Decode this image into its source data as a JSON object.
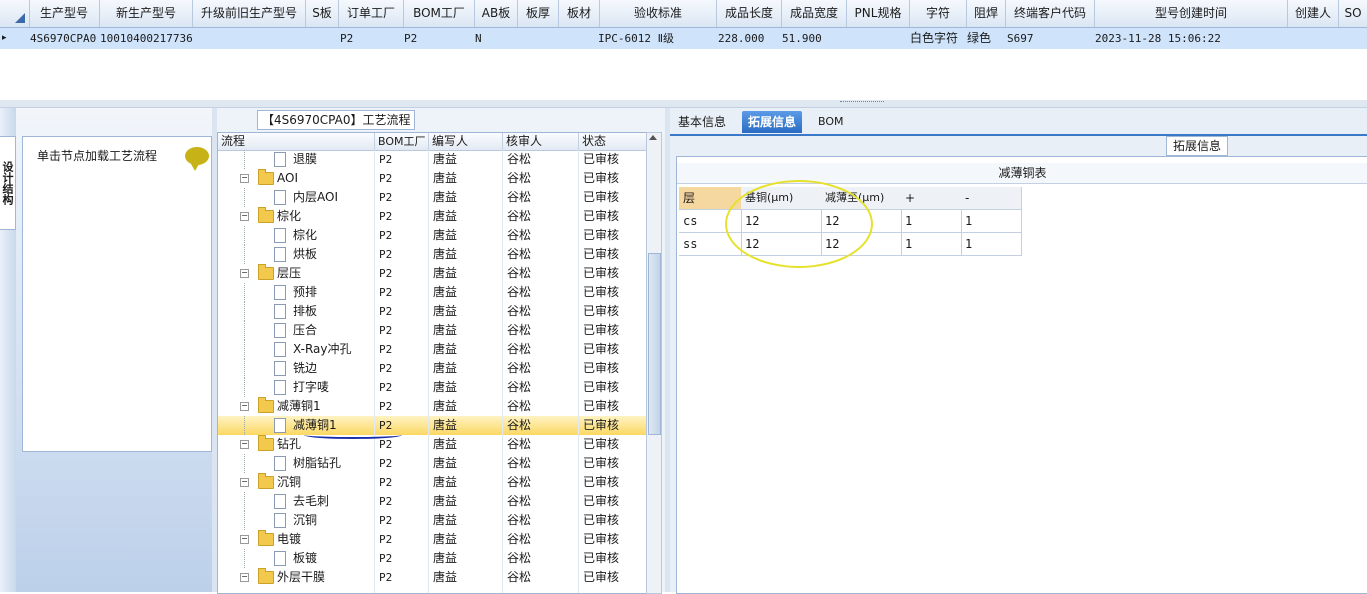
{
  "top_grid": {
    "columns": [
      "生产型号",
      "新生产型号",
      "升级前旧生产型号",
      "S板",
      "订单工厂",
      "BOM工厂",
      "AB板",
      "板厚",
      "板材",
      "验收标准",
      "成品长度",
      "成品宽度",
      "PNL规格",
      "字符",
      "阻焊",
      "终端客户代码",
      "型号创建时间",
      "创建人",
      "SO"
    ],
    "row": {
      "prod_model": "4S6970CPA0",
      "new_model": "10010400217736",
      "old_model": "",
      "s_board": "P2",
      "order_factory": "",
      "bom_factory": "P2",
      "ab_board": "N",
      "thickness": "",
      "material": "",
      "standard": "IPC-6012 Ⅱ级",
      "length": "228.000",
      "width": "51.900",
      "pnl": "",
      "char": "白色字符",
      "mask": "绿色",
      "customer": "S697",
      "created": "2023-11-28 15:06:22",
      "creator": "",
      "so": ""
    }
  },
  "left_panel": {
    "vertical_tab": "设计结构",
    "hint": "单击节点加载工艺流程",
    "bubble_icon": "speech-bubble-icon"
  },
  "mid_panel": {
    "title": "【4S6970CPA0】工艺流程",
    "headers": [
      "流程",
      "BOM工厂",
      "编写人",
      "核审人",
      "状态"
    ],
    "rows": [
      {
        "name": "退膜",
        "level": 1,
        "type": "page",
        "bom": "P2",
        "writer": "唐益",
        "reviewer": "谷松",
        "status": "已审核"
      },
      {
        "name": "AOI",
        "level": 0,
        "type": "folder",
        "bom": "P2",
        "writer": "唐益",
        "reviewer": "谷松",
        "status": "已审核"
      },
      {
        "name": "内层AOI",
        "level": 1,
        "type": "page",
        "bom": "P2",
        "writer": "唐益",
        "reviewer": "谷松",
        "status": "已审核"
      },
      {
        "name": "棕化",
        "level": 0,
        "type": "folder",
        "bom": "P2",
        "writer": "唐益",
        "reviewer": "谷松",
        "status": "已审核"
      },
      {
        "name": "棕化",
        "level": 1,
        "type": "page",
        "bom": "P2",
        "writer": "唐益",
        "reviewer": "谷松",
        "status": "已审核"
      },
      {
        "name": "烘板",
        "level": 1,
        "type": "page",
        "bom": "P2",
        "writer": "唐益",
        "reviewer": "谷松",
        "status": "已审核"
      },
      {
        "name": "层压",
        "level": 0,
        "type": "folder",
        "bom": "P2",
        "writer": "唐益",
        "reviewer": "谷松",
        "status": "已审核"
      },
      {
        "name": "预排",
        "level": 1,
        "type": "page",
        "bom": "P2",
        "writer": "唐益",
        "reviewer": "谷松",
        "status": "已审核"
      },
      {
        "name": "排板",
        "level": 1,
        "type": "page",
        "bom": "P2",
        "writer": "唐益",
        "reviewer": "谷松",
        "status": "已审核"
      },
      {
        "name": "压合",
        "level": 1,
        "type": "page",
        "bom": "P2",
        "writer": "唐益",
        "reviewer": "谷松",
        "status": "已审核"
      },
      {
        "name": "X-Ray冲孔",
        "level": 1,
        "type": "page",
        "bom": "P2",
        "writer": "唐益",
        "reviewer": "谷松",
        "status": "已审核"
      },
      {
        "name": "铣边",
        "level": 1,
        "type": "page",
        "bom": "P2",
        "writer": "唐益",
        "reviewer": "谷松",
        "status": "已审核"
      },
      {
        "name": "打字唛",
        "level": 1,
        "type": "page",
        "bom": "P2",
        "writer": "唐益",
        "reviewer": "谷松",
        "status": "已审核"
      },
      {
        "name": "减薄铜1",
        "level": 0,
        "type": "folder",
        "bom": "P2",
        "writer": "唐益",
        "reviewer": "谷松",
        "status": "已审核"
      },
      {
        "name": "减薄铜1",
        "level": 1,
        "type": "page",
        "bom": "P2",
        "writer": "唐益",
        "reviewer": "谷松",
        "status": "已审核",
        "selected": true
      },
      {
        "name": "钻孔",
        "level": 0,
        "type": "folder",
        "bom": "P2",
        "writer": "唐益",
        "reviewer": "谷松",
        "status": "已审核"
      },
      {
        "name": "树脂钻孔",
        "level": 1,
        "type": "page",
        "bom": "P2",
        "writer": "唐益",
        "reviewer": "谷松",
        "status": "已审核"
      },
      {
        "name": "沉铜",
        "level": 0,
        "type": "folder",
        "bom": "P2",
        "writer": "唐益",
        "reviewer": "谷松",
        "status": "已审核"
      },
      {
        "name": "去毛刺",
        "level": 1,
        "type": "page",
        "bom": "P2",
        "writer": "唐益",
        "reviewer": "谷松",
        "status": "已审核"
      },
      {
        "name": "沉铜",
        "level": 1,
        "type": "page",
        "bom": "P2",
        "writer": "唐益",
        "reviewer": "谷松",
        "status": "已审核"
      },
      {
        "name": "电镀",
        "level": 0,
        "type": "folder",
        "bom": "P2",
        "writer": "唐益",
        "reviewer": "谷松",
        "status": "已审核"
      },
      {
        "name": "板镀",
        "level": 1,
        "type": "page",
        "bom": "P2",
        "writer": "唐益",
        "reviewer": "谷松",
        "status": "已审核"
      },
      {
        "name": "外层干膜",
        "level": 0,
        "type": "folder",
        "bom": "P2",
        "writer": "唐益",
        "reviewer": "谷松",
        "status": "已审核"
      }
    ]
  },
  "right_panel": {
    "tabs": [
      {
        "label": "基本信息",
        "active": false
      },
      {
        "label": "拓展信息",
        "active": true
      },
      {
        "label": "BOM",
        "active": false
      }
    ],
    "section_title": "拓展信息",
    "table_caption": "减薄铜表",
    "table_headers": [
      "层",
      "基铜(μm)",
      "减薄至(μm)",
      "+",
      "-"
    ],
    "table_rows": [
      [
        "cs",
        "12",
        "12",
        "1",
        "1"
      ],
      [
        "ss",
        "12",
        "12",
        "1",
        "1"
      ]
    ]
  },
  "colors": {
    "selection": "#cfe3fa",
    "highlight_row": "#fbd863",
    "active_tab": "#2a6cc4",
    "annotation_ring": "#e6e12a",
    "annotation_pen": "#1a2fa8"
  }
}
